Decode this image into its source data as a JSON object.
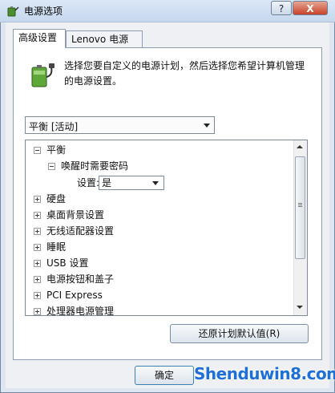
{
  "window": {
    "title": "电源选项",
    "help_label": "?",
    "close_label": "X"
  },
  "tabs": [
    {
      "label": "高级设置"
    },
    {
      "label": "Lenovo 电源管理"
    }
  ],
  "description": "选择您要自定义的电源计划，然后选择您希望计算机管理的电源设置。",
  "plan_select": {
    "value": "平衡 [活动]"
  },
  "tree": {
    "items": [
      {
        "label": "平衡",
        "expander": "minus"
      },
      {
        "label": "唤醒时需要密码",
        "expander": "minus"
      },
      {
        "label": "设置:",
        "value": "是"
      },
      {
        "label": "硬盘",
        "expander": "plus"
      },
      {
        "label": "桌面背景设置",
        "expander": "plus"
      },
      {
        "label": "无线适配器设置",
        "expander": "plus"
      },
      {
        "label": "睡眠",
        "expander": "plus"
      },
      {
        "label": "USB 设置",
        "expander": "plus"
      },
      {
        "label": "电源按钮和盖子",
        "expander": "plus"
      },
      {
        "label": "PCI Express",
        "expander": "plus"
      },
      {
        "label": "处理器电源管理",
        "expander": "plus"
      }
    ]
  },
  "buttons": {
    "restore": "还原计划默认值(R)",
    "ok": "确定"
  },
  "watermark": "Shenduwin8.com"
}
